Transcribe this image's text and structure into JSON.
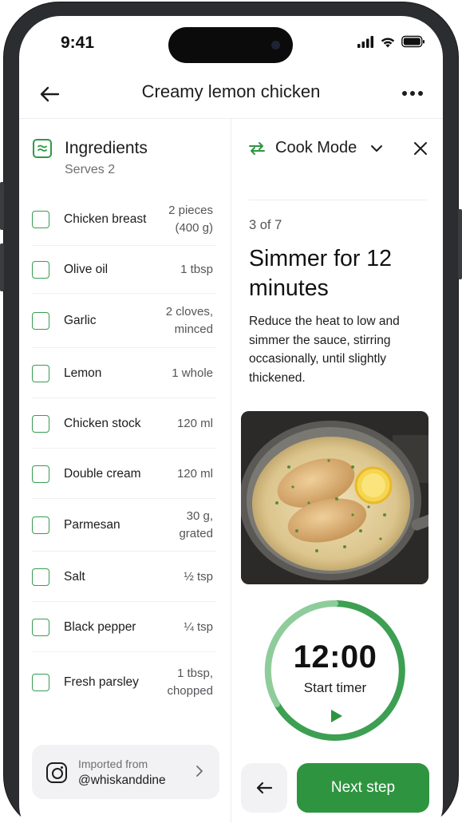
{
  "status_bar": {
    "time": "9:41"
  },
  "nav": {
    "title": "Creamy lemon chicken"
  },
  "ingredients": {
    "title": "Ingredients",
    "serves": "Serves 2",
    "items": [
      {
        "name": "Chicken breast",
        "amount": "2 pieces\n(400 g)"
      },
      {
        "name": "Olive oil",
        "amount": "1 tbsp"
      },
      {
        "name": "Garlic",
        "amount": "2 cloves,\nminced"
      },
      {
        "name": "Lemon",
        "amount": "1 whole"
      },
      {
        "name": "Chicken stock",
        "amount": "120 ml"
      },
      {
        "name": "Double cream",
        "amount": "120 ml"
      },
      {
        "name": "Parmesan",
        "amount": "30 g,\ngrated"
      },
      {
        "name": "Salt",
        "amount": "½ tsp"
      },
      {
        "name": "Black pepper",
        "amount": "¼ tsp"
      },
      {
        "name": "Fresh parsley",
        "amount": "1 tbsp,\nchopped"
      }
    ]
  },
  "imported": {
    "label": "Imported from",
    "handle": "@whiskanddine"
  },
  "cook_mode": {
    "label": "Cook Mode",
    "step_counter": "3 of 7",
    "step_title": "Simmer for 12 minutes",
    "step_description": "Reduce the heat to low and simmer the sauce, stirring occasionally, until slightly thickened.",
    "timer": {
      "time": "12:00",
      "label": "Start timer"
    },
    "next_label": "Next step"
  },
  "colors": {
    "accent": "#2e9440",
    "ring": "#cfe9d3"
  }
}
